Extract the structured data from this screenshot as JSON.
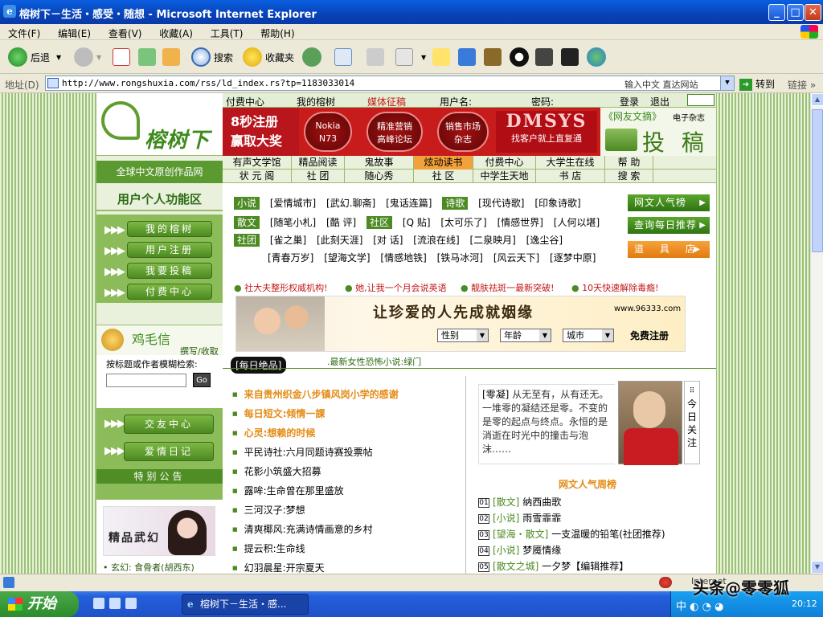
{
  "window": {
    "title": "榕树下－生活・感受・随想 - Microsoft Internet Explorer",
    "minimize": "_",
    "maximize": "□",
    "close": "✕"
  },
  "menu": [
    "文件(F)",
    "编辑(E)",
    "查看(V)",
    "收藏(A)",
    "工具(T)",
    "帮助(H)"
  ],
  "toolbar": {
    "back": "后退",
    "search": "搜索",
    "favorites": "收藏夹"
  },
  "address": {
    "label": "地址(D)",
    "url": "http://www.rongshuxia.com/rss/ld_index.rs?tp=1183033014",
    "hint": "输入中文 直达网站",
    "go": "转到",
    "links": "链接"
  },
  "site": {
    "logo": "榕树下",
    "slogan": "全球中文原创作品网",
    "topnav": [
      "付费中心",
      "我的榕树",
      "媒体征稿",
      "用户名:",
      "密码:",
      "登录",
      "退出"
    ],
    "banner": {
      "promo": [
        "8秒注册",
        "赢取大奖"
      ],
      "nokia": [
        "Nokia",
        "N73"
      ],
      "c2": [
        "精准营销",
        "高峰论坛"
      ],
      "c3": [
        "销售市场",
        "杂志"
      ],
      "dmsys": "DMSYS",
      "dmsys_sub": "找客户就上直复通",
      "mag": "《网友文摘》",
      "mag_sub": "电子杂志",
      "tougao": "投 稿"
    },
    "grid_row1": [
      "有声文学馆",
      "精品阅读",
      "鬼故事",
      "炫动读书",
      "付费中心",
      "大学生在线",
      "帮  助"
    ],
    "grid_row2": [
      "状 元 阁",
      "社  团",
      "随心秀",
      "社  区",
      "中学生天地",
      "书  店",
      "搜  索"
    ],
    "user_area": "用户个人功能区",
    "left_buttons": [
      "我的榕树",
      "用户注册",
      "我要投稿",
      "付费中心"
    ],
    "jimao": {
      "title": "鸡毛信",
      "sub": "撰写/收取"
    },
    "search": {
      "label": "按标题或作者模糊检索:",
      "go": "Go"
    },
    "left_buttons2": [
      "交友中心",
      "爱情日记"
    ],
    "notice": "特别公告",
    "promo": {
      "title": "精品武幻",
      "caption": "• 玄幻: 食骨者(胡西东)"
    },
    "rows": {
      "r1_tag": "小说",
      "r1": [
        "[爱情城市]",
        "[武幻.聊斋]",
        "[鬼话连篇]"
      ],
      "r1_tag2": "诗歌",
      "r1b": [
        "[现代诗歌]",
        "[印象诗歌]"
      ],
      "r2_tag": "散文",
      "r2": [
        "[随笔小札]",
        "[酷  评]"
      ],
      "r2_tag2": "社区",
      "r2b": [
        "[Q  贴]",
        "[太可乐了]",
        "[情感世界]",
        "[人何以堪]"
      ],
      "r3_tag": "社团",
      "r3": [
        "[雀之巢]",
        "[此刻天涯]",
        "[对  话]",
        "[流浪在线]",
        "[二泉映月]",
        "[逸尘谷]"
      ],
      "r4": [
        "[青春万岁]",
        "[望海文学]",
        "[情感地铁]",
        "[铁马冰河]",
        "[风云天下]",
        "[逐梦中原]"
      ]
    },
    "side_buttons": [
      "网文人气榜",
      "查询每日推荐",
      "道 具 店"
    ],
    "ad_texts": [
      "社大夫整形权威机构!",
      "她,让我一个月会说英语",
      "靓肤祛斑一最新突破!",
      "10天快速解除毒瘾!"
    ],
    "ad": {
      "title": "让珍爱的人先成就姻缘",
      "url": "www.96333.com",
      "sel1": "性别",
      "sel2": "年龄",
      "sel3": "城市",
      "register": "免费注册"
    },
    "daily": {
      "header": "[每日绝品]",
      "novel": ".最新女性恐怖小说:绿门"
    },
    "articles": [
      "来自贵州织金八步镇风岗小学的感谢",
      "每日短文:倾情一課",
      "心灵:想赖的时候",
      "平民诗社:六月同题诗赛投票帖",
      "花影小筑盛大招募",
      "露哞:生命曾在那里盛放",
      "三河汉子:梦想",
      "清爽椰风:充满诗情画意的乡村",
      "提云积:生命线",
      "幻羽晨星:开宗夏天"
    ],
    "quote": {
      "name": "[零凝]",
      "text": "从无至有，从有还无。一堆零的凝结还是零。不变的是零的起点与终点。永恒的是消逝在时光中的撞击与泡沫……"
    },
    "today": "今日关注",
    "popular_title": "网文人气周榜",
    "ranks": [
      {
        "no": "01",
        "cat": "[散文]",
        "title": "纳西曲歌"
      },
      {
        "no": "02",
        "cat": "[小说]",
        "title": "雨雪霏霏"
      },
      {
        "no": "03",
        "cat": "[望海・散文]",
        "title": "一支温暖的铅笔(社团推荐)"
      },
      {
        "no": "04",
        "cat": "[小说]",
        "title": "梦魇情缘"
      },
      {
        "no": "05",
        "cat": "[散文之城]",
        "title": "一夕梦【编辑推荐】"
      }
    ]
  },
  "status": {
    "text": "Internet"
  },
  "taskbar": {
    "start": "开始",
    "task": "榕树下－生活・感...",
    "ime": "中",
    "clock": "20:12"
  },
  "watermark": "头条@零零狐"
}
